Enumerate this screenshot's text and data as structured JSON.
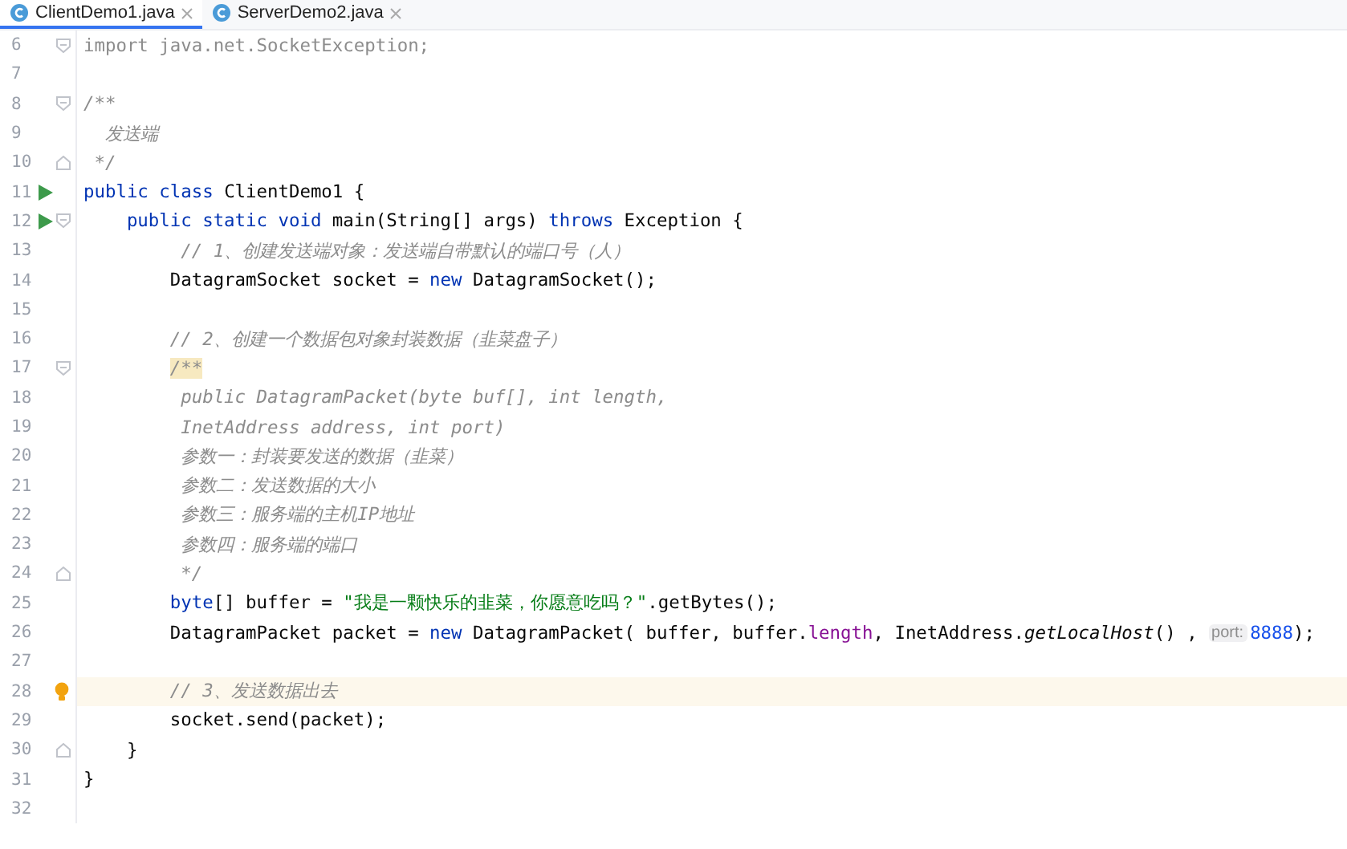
{
  "tabs": [
    {
      "label": "ClientDemo1.java",
      "selected": true
    },
    {
      "label": "ServerDemo2.java",
      "selected": false
    }
  ],
  "lines": [
    {
      "number": "6",
      "current": false,
      "marks": [
        {
          "kind": "fold"
        }
      ],
      "tokens": [
        {
          "text": "import java.net.SocketException;",
          "kind": "unused"
        }
      ]
    },
    {
      "number": "7",
      "current": false
    },
    {
      "number": "8",
      "current": false,
      "marks": [
        {
          "kind": "fold"
        }
      ],
      "tokens": [
        {
          "text": "/**",
          "kind": "doc"
        }
      ]
    },
    {
      "number": "9",
      "current": false,
      "tokens": [
        {
          "text": "  发送端",
          "kind": "doc"
        }
      ]
    },
    {
      "number": "10",
      "current": false,
      "marks": [
        {
          "kind": "foldend"
        }
      ],
      "tokens": [
        {
          "text": " */",
          "kind": "doc"
        }
      ]
    },
    {
      "number": "11",
      "current": false,
      "marks": [
        {
          "kind": "run"
        }
      ],
      "tokens": [
        {
          "text": "public class ",
          "kind": "keyword"
        },
        {
          "text": "ClientDemo1 {",
          "kind": "plain"
        }
      ]
    },
    {
      "number": "12",
      "current": false,
      "marks": [
        {
          "kind": "run"
        },
        {
          "kind": "fold"
        }
      ],
      "tokens": [
        {
          "text": "    public static void ",
          "kind": "keyword"
        },
        {
          "text": "main(String[] args) ",
          "kind": "plain"
        },
        {
          "text": "throws ",
          "kind": "keyword"
        },
        {
          "text": "Exception {",
          "kind": "plain"
        }
      ]
    },
    {
      "number": "13",
      "current": false,
      "tokens": [
        {
          "text": "         // 1、创建发送端对象：发送端自带默认的端口号（人）",
          "kind": "comment"
        }
      ]
    },
    {
      "number": "14",
      "current": false,
      "tokens": [
        {
          "text": "        DatagramSocket socket = ",
          "kind": "plain"
        },
        {
          "text": "new ",
          "kind": "keyword"
        },
        {
          "text": "DatagramSocket();",
          "kind": "plain"
        }
      ]
    },
    {
      "number": "15",
      "current": false
    },
    {
      "number": "16",
      "current": false,
      "tokens": [
        {
          "text": "        // 2、创建一个数据包对象封装数据（韭菜盘子）",
          "kind": "comment"
        }
      ]
    },
    {
      "number": "17",
      "current": false,
      "marks": [
        {
          "kind": "fold"
        }
      ],
      "tokens": [
        {
          "text": "        /**",
          "kind": "docmatch"
        }
      ]
    },
    {
      "number": "18",
      "current": false,
      "tokens": [
        {
          "text": "         public DatagramPacket(byte buf[], int length,",
          "kind": "doc"
        }
      ]
    },
    {
      "number": "19",
      "current": false,
      "tokens": [
        {
          "text": "         InetAddress address, int port)",
          "kind": "doc"
        }
      ]
    },
    {
      "number": "20",
      "current": false,
      "tokens": [
        {
          "text": "         参数一：封装要发送的数据（韭菜）",
          "kind": "doc"
        }
      ]
    },
    {
      "number": "21",
      "current": false,
      "tokens": [
        {
          "text": "         参数二：发送数据的大小",
          "kind": "doc"
        }
      ]
    },
    {
      "number": "22",
      "current": false,
      "tokens": [
        {
          "text": "         参数三：服务端的主机IP地址",
          "kind": "doc"
        }
      ]
    },
    {
      "number": "23",
      "current": false,
      "tokens": [
        {
          "text": "         参数四：服务端的端口",
          "kind": "doc"
        }
      ]
    },
    {
      "number": "24",
      "current": false,
      "marks": [
        {
          "kind": "foldend"
        }
      ],
      "tokens": [
        {
          "text": "         */",
          "kind": "doc"
        }
      ]
    },
    {
      "number": "25",
      "current": false,
      "tokens": [
        {
          "text": "        byte",
          "kind": "keyword"
        },
        {
          "text": "[] buffer = ",
          "kind": "plain"
        },
        {
          "text": "\"我是一颗快乐的韭菜，你愿意吃吗？\"",
          "kind": "string"
        },
        {
          "text": ".getBytes();",
          "kind": "plain"
        }
      ]
    },
    {
      "number": "26",
      "current": false,
      "tokens": [
        {
          "text": "        DatagramPacket packet = ",
          "kind": "plain"
        },
        {
          "text": "new ",
          "kind": "keyword"
        },
        {
          "text": "DatagramPacket( buffer, buffer.",
          "kind": "plain"
        },
        {
          "text": "length",
          "kind": "field"
        },
        {
          "text": ", InetAddress.",
          "kind": "plain"
        },
        {
          "text": "getLocalHost",
          "kind": "static"
        },
        {
          "text": "() , ",
          "kind": "plain"
        },
        {
          "text": "port:",
          "kind": "hint"
        },
        {
          "text": "8888",
          "kind": "number"
        },
        {
          "text": ");",
          "kind": "plain"
        }
      ]
    },
    {
      "number": "27",
      "current": false
    },
    {
      "number": "28",
      "current": true,
      "marks": [
        {
          "kind": "bulb"
        }
      ],
      "tokens": [
        {
          "text": "        // 3、发送数据出去",
          "kind": "comment"
        }
      ]
    },
    {
      "number": "29",
      "current": false,
      "tokens": [
        {
          "text": "        socket.send(packet);",
          "kind": "plain"
        }
      ]
    },
    {
      "number": "30",
      "current": false,
      "marks": [
        {
          "kind": "foldend"
        }
      ],
      "tokens": [
        {
          "text": "    }",
          "kind": "plain"
        }
      ]
    },
    {
      "number": "31",
      "current": false,
      "tokens": [
        {
          "text": "}",
          "kind": "plain"
        }
      ]
    },
    {
      "number": "32",
      "current": false
    }
  ]
}
